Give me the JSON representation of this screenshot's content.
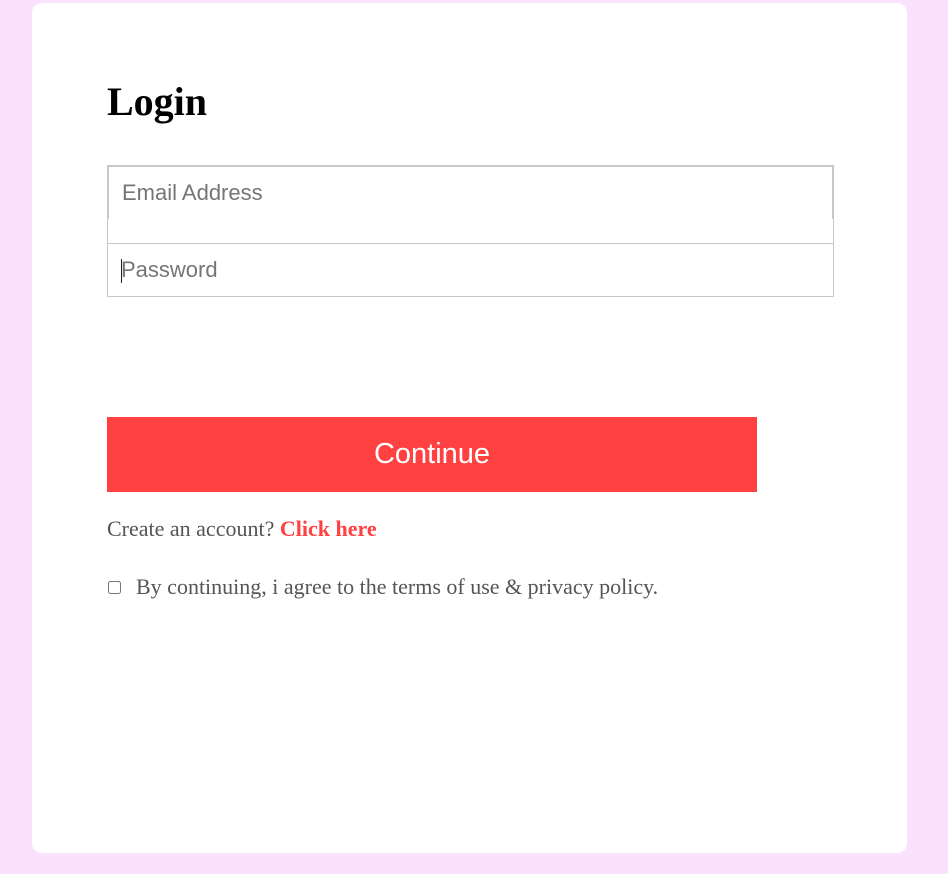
{
  "login_form": {
    "title": "Login",
    "email": {
      "placeholder": "Email Address",
      "value": ""
    },
    "password": {
      "placeholder": "Password",
      "value": ""
    },
    "continue_label": "Continue",
    "signup_prompt": "Create an account?",
    "signup_link_label": "Click here",
    "terms": {
      "checked": false,
      "label": "By continuing, i agree to the terms of use & privacy policy."
    }
  },
  "colors": {
    "page_background": "#fae2fd",
    "card_background": "#ffffff",
    "accent": "#ff4141",
    "field_border": "#c8c8c8",
    "body_text": "#555555"
  }
}
